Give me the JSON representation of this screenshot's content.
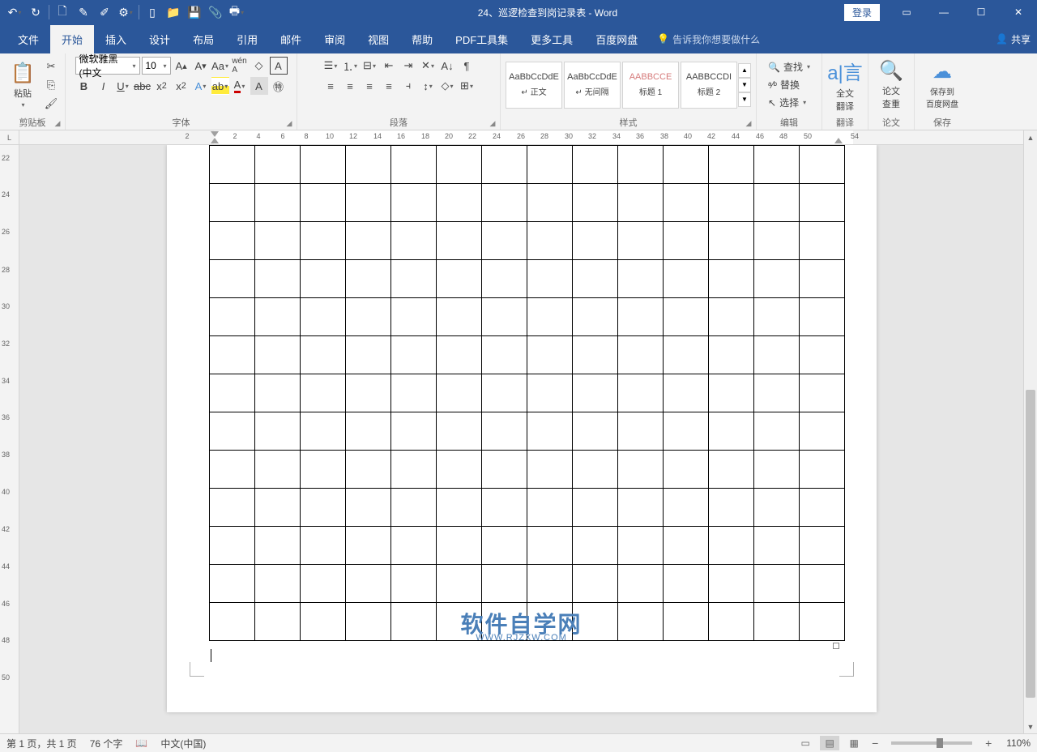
{
  "app": {
    "title": "24、巡逻检查到岗记录表  -  Word"
  },
  "qat": {
    "undo": "↶",
    "redo": "↷"
  },
  "titlebar": {
    "login": "登录"
  },
  "menu": {
    "file": "文件",
    "home": "开始",
    "insert": "插入",
    "design": "设计",
    "layout": "布局",
    "references": "引用",
    "mailings": "邮件",
    "review": "审阅",
    "view": "视图",
    "help": "帮助",
    "pdf": "PDF工具集",
    "more": "更多工具",
    "baidu": "百度网盘",
    "tellme": "告诉我你想要做什么",
    "share": "共享"
  },
  "ribbon": {
    "clipboard": {
      "label": "剪贴板",
      "paste": "粘贴"
    },
    "font": {
      "label": "字体",
      "name": "微软雅黑 (中文",
      "size": "10"
    },
    "paragraph": {
      "label": "段落"
    },
    "styles": {
      "label": "样式",
      "items": [
        {
          "preview": "AaBbCcDdE",
          "name": "↵ 正文",
          "cls": ""
        },
        {
          "preview": "AaBbCcDdE",
          "name": "↵ 无间隔",
          "cls": ""
        },
        {
          "preview": "AABBCCE",
          "name": "标题 1",
          "cls": "heading1"
        },
        {
          "preview": "AABBCCDI",
          "name": "标题 2",
          "cls": ""
        }
      ]
    },
    "editing": {
      "label": "编辑",
      "find": "查找",
      "replace": "替换",
      "select": "选择"
    },
    "translate": {
      "label": "翻译",
      "full": "全文\n翻译"
    },
    "paper": {
      "label": "论文",
      "check": "论文\n查重"
    },
    "save": {
      "label": "保存",
      "baidu": "保存到\n百度网盘"
    }
  },
  "ruler": {
    "h": [
      "2",
      "2",
      "4",
      "6",
      "8",
      "10",
      "12",
      "14",
      "16",
      "18",
      "20",
      "22",
      "24",
      "26",
      "28",
      "30",
      "32",
      "34",
      "36",
      "38",
      "40",
      "42",
      "44",
      "46",
      "48",
      "50",
      "54"
    ],
    "hpos": [
      231,
      290,
      319,
      349,
      378,
      407,
      436,
      466,
      495,
      525,
      554,
      583,
      613,
      643,
      672,
      702,
      731,
      761,
      790,
      820,
      849,
      878,
      908,
      938,
      967,
      997,
      1055
    ],
    "v": [
      "22",
      "24",
      "26",
      "28",
      "30",
      "32",
      "34",
      "36",
      "38",
      "40",
      "42",
      "44",
      "46",
      "48",
      "50"
    ],
    "vpos": [
      16,
      61,
      107,
      154,
      199,
      245,
      291,
      336,
      382,
      428,
      474,
      520,
      566,
      611,
      657
    ]
  },
  "watermark": {
    "main": "软件自学网",
    "sub": "WWW.RJZXW.COM"
  },
  "status": {
    "page": "第 1 页，共 1 页",
    "words": "76 个字",
    "lang": "中文(中国)",
    "zoom": "110%"
  }
}
